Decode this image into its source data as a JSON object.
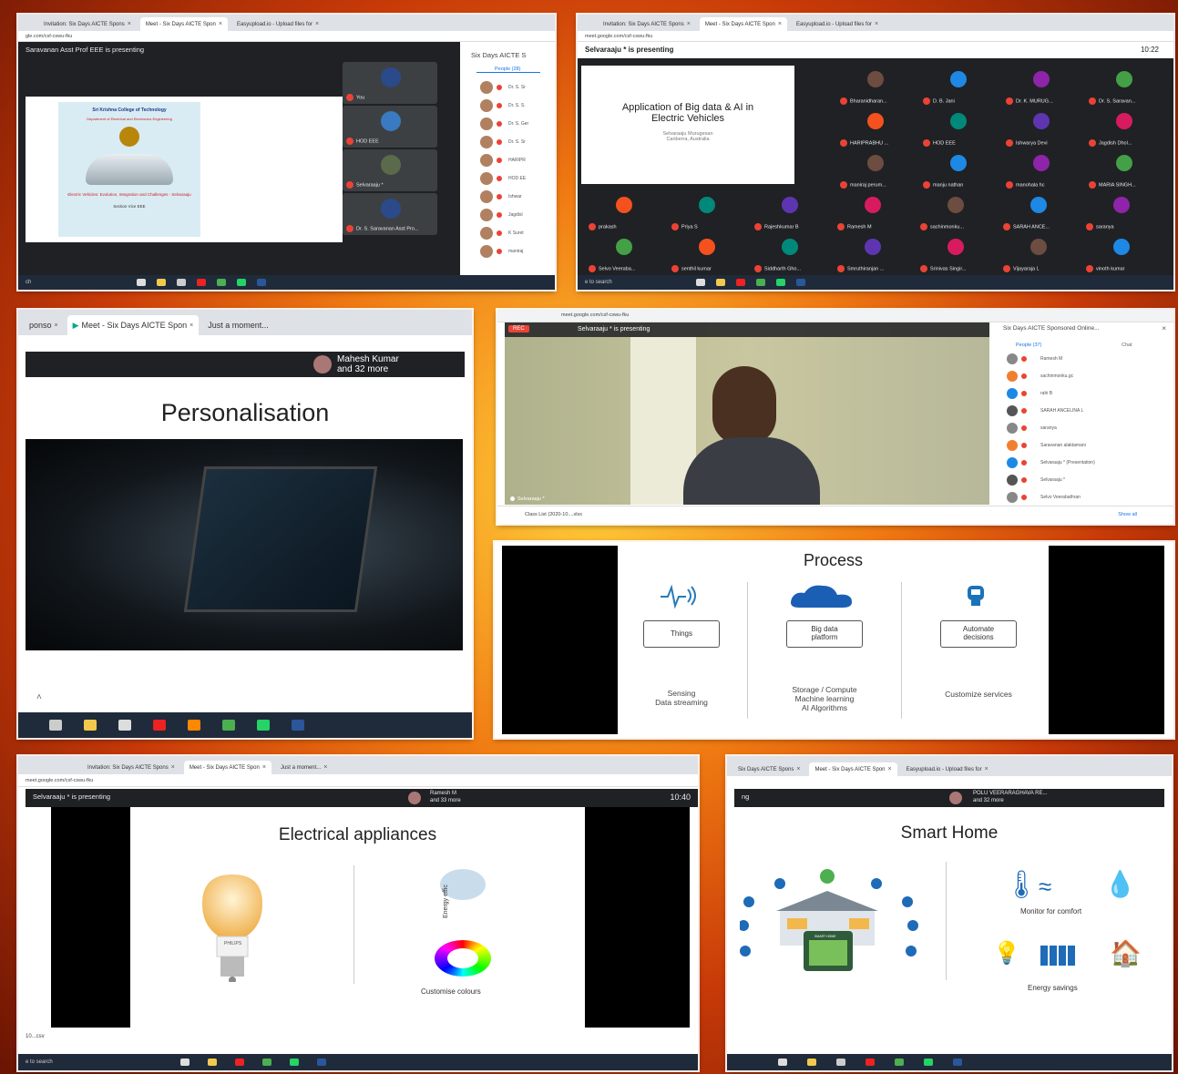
{
  "panel1": {
    "tabs": [
      "Invitation: Six Days AICTE Spons",
      "Meet - Six Days AICTE Spon",
      "Easyupload.io - Upload files for"
    ],
    "url": "gle.com/csf-cswu-fku",
    "presenting": "Saravanan Asst Prof EEE is presenting",
    "sidebar_title": "Six Days AICTE S",
    "people_label": "People (28)",
    "tiles": [
      "You",
      "HOD EEE",
      "Selvaraaju *",
      "Dr. S. Saravanan Asst Pro..."
    ],
    "people": [
      "Dr. S. Sr",
      "Dr. S. S.",
      "Dr. S. Ger",
      "Dr. S. Sr",
      "HARIPR",
      "HOD EE",
      "Ishwar",
      "Jagdisl",
      "K Suret",
      "maniraj"
    ],
    "slide": {
      "college": "Sri Krishna College of Technology",
      "dept": "Department of Electrical and Electronics Engineering",
      "title": "Electric Vehicles: Evolution, Integration and Challenges - Selvaraaju",
      "footer": "Section Vice EEE"
    },
    "search": "ch",
    "icon": "presentation-icon"
  },
  "panel2": {
    "tabs": [
      "Invitation: Six Days AICTE Spons",
      "Meet - Six Days AICTE Spon",
      "Easyupload.io - Upload files for"
    ],
    "url": "meet.google.com/csf-cswu-fku",
    "presenting": "Selvaraaju * is presenting",
    "time": "10:22",
    "slide_title": "Application of Big data & AI in Electric Vehicles",
    "slide_author": "Selvaraaju Murugesan",
    "slide_place": "Canberra, Australia",
    "participants": [
      "Bharanidharan...",
      "D. B. Jani",
      "Dr. K. MURUG...",
      "Dr. S. Saravan...",
      "HARIPRABHU ...",
      "HOD EEE",
      "Ishwarya Devi",
      "Jagdish Dhol...",
      "maniraj perum...",
      "manju nathan",
      "manohala hc",
      "MARIA SINGH...",
      "prakash",
      "Priya S",
      "Rajeshkumar B",
      "Ramesh M",
      "sachinmonku...",
      "SARAH ANCE...",
      "saranya",
      "Selvo Veeraba...",
      "senthil kumar",
      "Siddharth Gho...",
      "Smruthiranjan ...",
      "Srinivas Singir...",
      "Vijayaraja L",
      "vinoth kumar"
    ],
    "search": "e to search"
  },
  "panel3": {
    "tabs": [
      "ponso",
      "Meet - Six Days AICTE Spon",
      "Just a moment..."
    ],
    "presenter_name": "Mahesh Kumar",
    "presenter_more": "and 32 more",
    "slide_title": "Personalisation"
  },
  "panel4": {
    "url": "meet.google.com/csf-cswu-fku",
    "rec": "REC",
    "presenting": "Selvaraaju * is presenting",
    "sidebar_title": "Six Days AICTE Sponsored Online...",
    "people_label": "People (37)",
    "chat_label": "Chat",
    "people": [
      "Ramesh M",
      "sachinmonku.gc",
      "rahi B",
      "SARAH ANCELINA L",
      "saranya",
      "Saravanan alaktamani",
      "Selvaraaju * (Presentation)",
      "Selvaraaju *",
      "Selvo Veerabathran"
    ],
    "self_label": "Selvaraaju *",
    "download": "Class List (2020-10....xlsx",
    "show_all": "Show all"
  },
  "panel5": {
    "title": "Process",
    "cols": [
      {
        "box": "Things",
        "caption": "Sensing\nData streaming"
      },
      {
        "box": "Big data\nplatform",
        "caption": "Storage / Compute\nMachine learning\nAI Algorithms"
      },
      {
        "box": "Automate\ndecisions",
        "caption": "Customize services"
      }
    ]
  },
  "panel6": {
    "tabs": [
      "Invitation: Six Days AICTE Spons",
      "Meet - Six Days AICTE Spon",
      "Just a moment..."
    ],
    "url": "meet.google.com/csf-cswu-fku",
    "presenting": "Selvaraaju * is presenting",
    "presenter_name": "Ramesh M",
    "presenter_more": "and 33 more",
    "time": "10:40",
    "slide_title": "Electrical appliances",
    "bulb_brand": "PHILIPS",
    "energy_label": "Energy effic",
    "colours_label": "Customise colours",
    "download": "10...csv",
    "search": "e to search"
  },
  "panel7": {
    "tabs": [
      "Six Days AICTE Spons",
      "Meet - Six Days AICTE Spon",
      "Easyupload.io - Upload files for"
    ],
    "presenting": "ng",
    "presenter_name": "POLU VEERARAGHAVA RE...",
    "presenter_more": "and 32 more",
    "slide_title": "Smart Home",
    "monitor_label": "Monitor for comfort",
    "energy_label": "Energy savings",
    "phone_label": "SMART HOME"
  },
  "colors": {
    "meet_dark": "#202124",
    "tile": "#3c4043",
    "mic_off": "#ea4335",
    "accent_blue": "#1a73e8"
  }
}
